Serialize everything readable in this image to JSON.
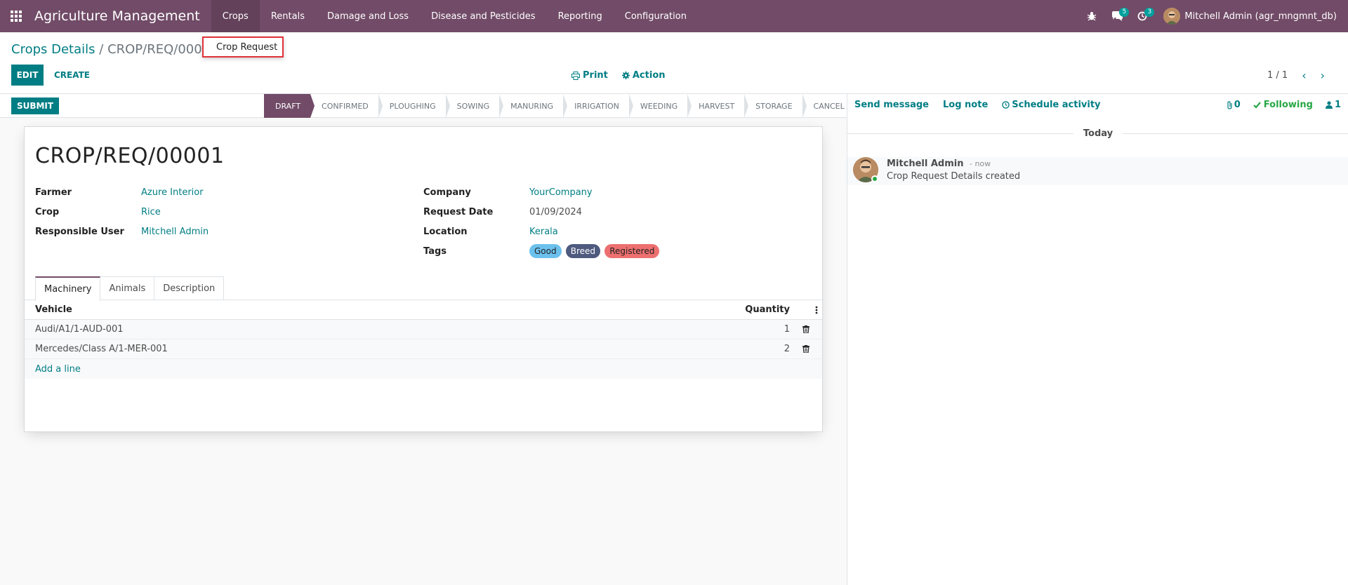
{
  "navbar": {
    "brand": "Agriculture Management",
    "menu": [
      "Crops",
      "Rentals",
      "Damage and Loss",
      "Disease and Pesticides",
      "Reporting",
      "Configuration"
    ],
    "messages_count": "5",
    "activities_count": "3",
    "user": "Mitchell Admin (agr_mngmnt_db)"
  },
  "dropdown": {
    "item": "Crop Request"
  },
  "breadcrumb": {
    "parent": "Crops Details",
    "separator": "/",
    "current": "CROP/REQ/00001"
  },
  "toolbar": {
    "edit": "EDIT",
    "create": "CREATE",
    "print": "Print",
    "action": "Action",
    "pager": "1 / 1"
  },
  "statusbar": {
    "submit": "SUBMIT",
    "stages": [
      "DRAFT",
      "CONFIRMED",
      "PLOUGHING",
      "SOWING",
      "MANURING",
      "IRRIGATION",
      "WEEDING",
      "HARVEST",
      "STORAGE",
      "CANCEL"
    ],
    "active_stage": "DRAFT"
  },
  "form": {
    "title": "CROP/REQ/00001",
    "left": [
      {
        "label": "Farmer",
        "value": "Azure Interior"
      },
      {
        "label": "Crop",
        "value": "Rice"
      },
      {
        "label": "Responsible User",
        "value": "Mitchell Admin"
      }
    ],
    "right": [
      {
        "label": "Company",
        "value": "YourCompany"
      },
      {
        "label": "Request Date",
        "value": "01/09/2024"
      },
      {
        "label": "Location",
        "value": "Kerala"
      },
      {
        "label": "Tags",
        "value": ""
      }
    ],
    "tags": [
      {
        "name": "Good",
        "bg": "#6cc1ed",
        "fg": "#222222"
      },
      {
        "name": "Breed",
        "bg": "#4e5a7e",
        "fg": "#ffffff"
      },
      {
        "name": "Registered",
        "bg": "#ed6f6f",
        "fg": "#222222"
      }
    ],
    "tabs": [
      "Machinery",
      "Animals",
      "Description"
    ],
    "list": {
      "col_vehicle": "Vehicle",
      "col_quantity": "Quantity",
      "rows": [
        {
          "vehicle": "Audi/A1/1-AUD-001",
          "quantity": "1"
        },
        {
          "vehicle": "Mercedes/Class A/1-MER-001",
          "quantity": "2"
        }
      ],
      "add_line": "Add a line"
    }
  },
  "chatter": {
    "send_message": "Send message",
    "log_note": "Log note",
    "schedule_activity": "Schedule activity",
    "attachments": "0",
    "following": "Following",
    "followers": "1",
    "today": "Today",
    "message": {
      "author": "Mitchell Admin",
      "date": "- now",
      "body": "Crop Request Details created"
    }
  },
  "colors": {
    "brand": "#714b67",
    "accent": "#017e84",
    "following": "#28a745"
  }
}
